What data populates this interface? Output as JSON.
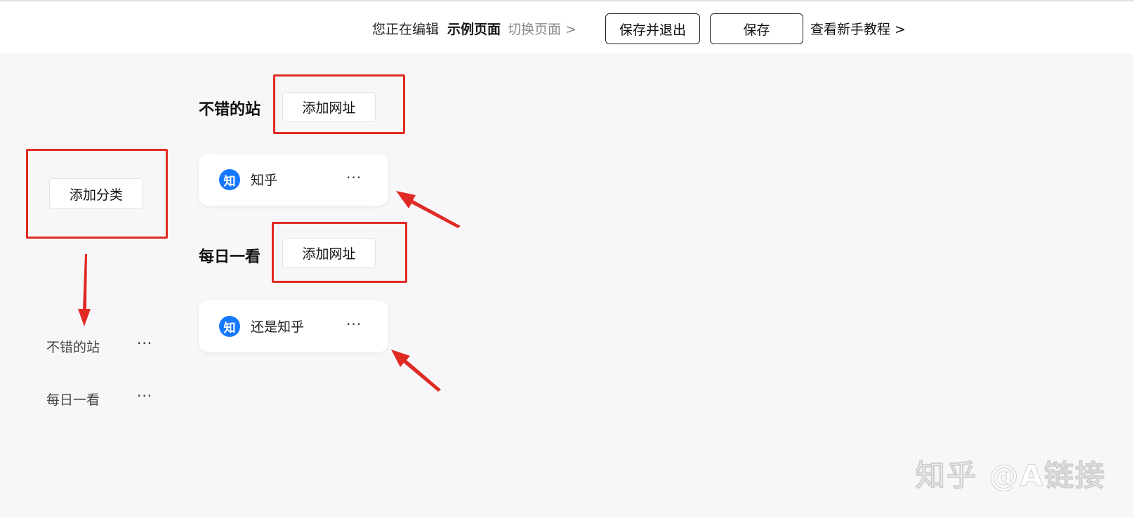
{
  "header": {
    "editing_label": "您正在编辑",
    "page_name": "示例页面",
    "switch_page": "切换页面 >",
    "save_exit_label": "保存并退出",
    "save_label": "保存",
    "tutorial_label": "查看新手教程 >"
  },
  "sidebar": {
    "add_category_label": "添加分类",
    "items": [
      {
        "label": "不错的站",
        "more": "···"
      },
      {
        "label": "每日一看",
        "more": "···"
      }
    ]
  },
  "sections": [
    {
      "title": "不错的站",
      "add_url_label": "添加网址",
      "sites": [
        {
          "icon_text": "知",
          "name": "知乎",
          "more": "···"
        }
      ]
    },
    {
      "title": "每日一看",
      "add_url_label": "添加网址",
      "sites": [
        {
          "icon_text": "知",
          "name": "还是知乎",
          "more": "···"
        }
      ]
    }
  ],
  "watermark": "知乎 @A链接",
  "colors": {
    "annotation_red": "#e02b24",
    "site_icon_blue": "#1677ff",
    "background": "#f7f7f9"
  }
}
